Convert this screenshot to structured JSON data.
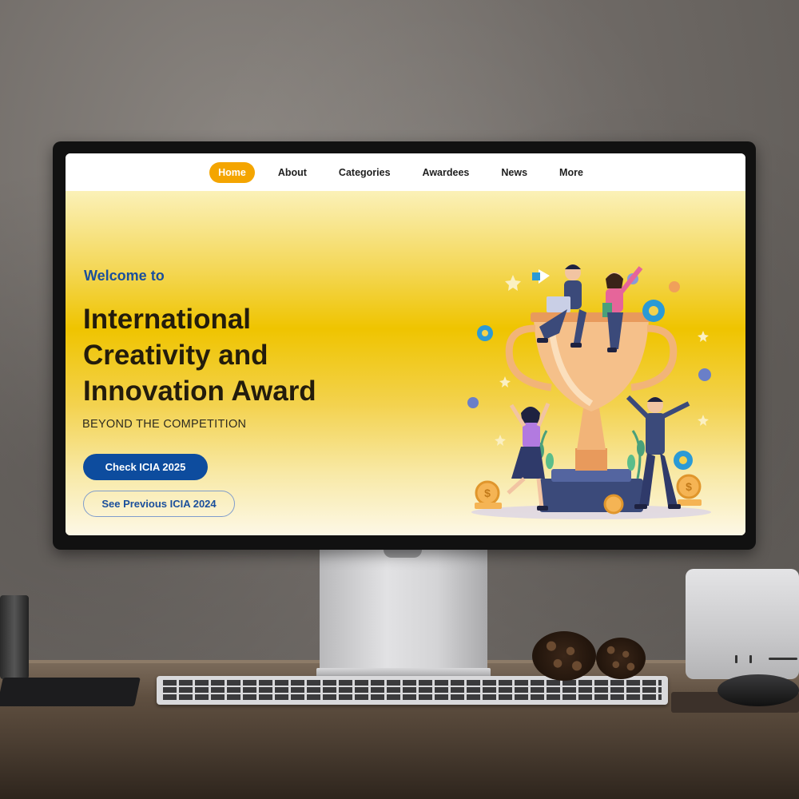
{
  "nav": {
    "items": [
      {
        "label": "Home",
        "active": true
      },
      {
        "label": "About",
        "active": false
      },
      {
        "label": "Categories",
        "active": false
      },
      {
        "label": "Awardees",
        "active": false
      },
      {
        "label": "News",
        "active": false
      },
      {
        "label": "More",
        "active": false
      }
    ]
  },
  "hero": {
    "welcome": "Welcome to",
    "title_lines": [
      "International",
      "Creativity and",
      "Innovation Award"
    ],
    "tagline": "BEYOND THE COMPETITION",
    "primary_button": "Check ICIA 2025",
    "secondary_button": "See Previous ICIA 2024"
  },
  "colors": {
    "accent": "#f4a500",
    "primary_blue": "#0d4c9e",
    "hero_yellow": "#efc400"
  },
  "icons": [
    "trophy-icon",
    "megaphone-icon",
    "gear-icon",
    "star-icon",
    "coin-icon"
  ]
}
